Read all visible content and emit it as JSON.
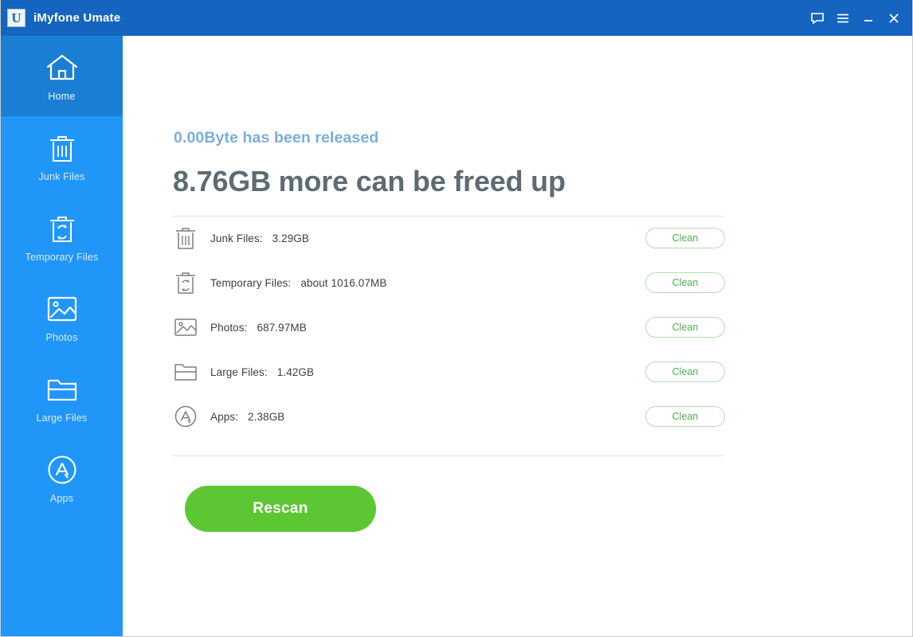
{
  "window": {
    "title": "iMyfone Umate",
    "logo_letter": "U",
    "controls": [
      {
        "name": "feedback-icon",
        "label": "Feedback"
      },
      {
        "name": "menu-icon",
        "label": "Menu"
      },
      {
        "name": "minimize-icon",
        "label": "Minimize"
      },
      {
        "name": "close-icon",
        "label": "Close"
      }
    ]
  },
  "sidebar": {
    "items": [
      {
        "label": "Home",
        "icon": "home-icon",
        "active": true
      },
      {
        "label": "Junk Files",
        "icon": "trash-icon",
        "active": false
      },
      {
        "label": "Temporary Files",
        "icon": "recycle-trash-icon",
        "active": false
      },
      {
        "label": "Photos",
        "icon": "photo-icon",
        "active": false
      },
      {
        "label": "Large Files",
        "icon": "folder-icon",
        "active": false
      },
      {
        "label": "Apps",
        "icon": "appstore-icon",
        "active": false
      }
    ]
  },
  "main": {
    "released_text": "0.00Byte has been released",
    "headline": "8.76GB more can be freed up",
    "rescan_label": "Rescan",
    "clean_label": "Clean",
    "rows": [
      {
        "label": "Junk Files:",
        "value": "3.29GB",
        "icon": "trash-icon",
        "action": "Clean"
      },
      {
        "label": "Temporary Files:",
        "value": "about 1016.07MB",
        "icon": "recycle-trash-icon",
        "action": "Clean"
      },
      {
        "label": "Photos:",
        "value": "687.97MB",
        "icon": "photo-icon",
        "action": "Clean"
      },
      {
        "label": "Large Files:",
        "value": "1.42GB",
        "icon": "folder-icon",
        "action": "Clean"
      },
      {
        "label": "Apps:",
        "value": "2.38GB",
        "icon": "appstore-icon",
        "action": "Clean"
      }
    ]
  },
  "colors": {
    "titlebar": "#1565c0",
    "sidebar": "#2196f9",
    "sidebar_active": "#1a7fd4",
    "released_text": "#7aaedd",
    "headline": "#5e6b73",
    "rescan": "#5cc733",
    "clean_border": "#b2dfb4",
    "clean_text": "#4caf50"
  }
}
